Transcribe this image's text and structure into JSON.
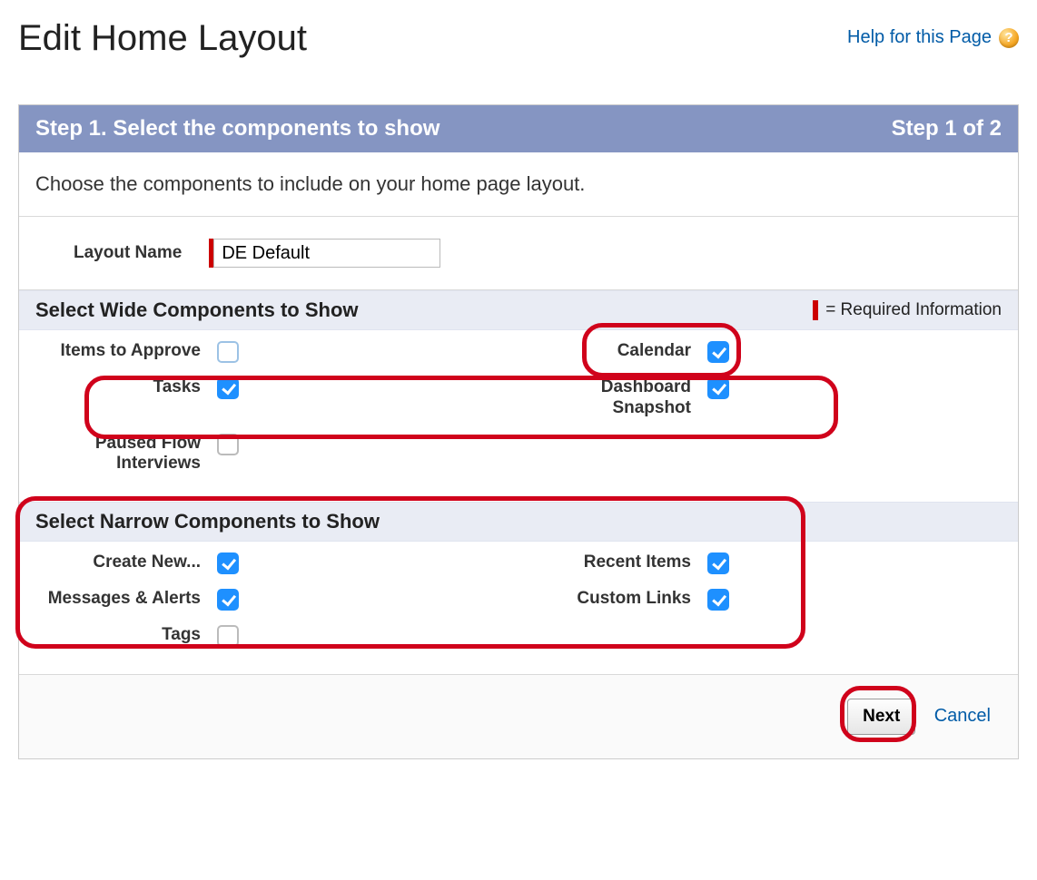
{
  "page": {
    "title": "Edit Home Layout",
    "help_label": "Help for this Page"
  },
  "wizard": {
    "step_title": "Step 1. Select the components to show",
    "step_counter": "Step 1 of 2",
    "instructions": "Choose the components to include on your home page layout.",
    "layout_name_label": "Layout Name",
    "layout_name_value": "DE Default",
    "required_info_label": "= Required Information"
  },
  "sections": {
    "wide": {
      "title": "Select Wide Components to Show",
      "items": {
        "items_to_approve": {
          "label": "Items to Approve",
          "checked": false
        },
        "calendar": {
          "label": "Calendar",
          "checked": true
        },
        "tasks": {
          "label": "Tasks",
          "checked": true
        },
        "dashboard_snapshot": {
          "label": "Dashboard Snapshot",
          "checked": true
        },
        "paused_flow": {
          "label": "Paused Flow Interviews",
          "checked": false
        }
      }
    },
    "narrow": {
      "title": "Select Narrow Components to Show",
      "items": {
        "create_new": {
          "label": "Create New...",
          "checked": true
        },
        "recent_items": {
          "label": "Recent Items",
          "checked": true
        },
        "messages_alerts": {
          "label": "Messages & Alerts",
          "checked": true
        },
        "custom_links": {
          "label": "Custom Links",
          "checked": true
        },
        "tags": {
          "label": "Tags",
          "checked": false
        }
      }
    }
  },
  "footer": {
    "next_label": "Next",
    "cancel_label": "Cancel"
  }
}
